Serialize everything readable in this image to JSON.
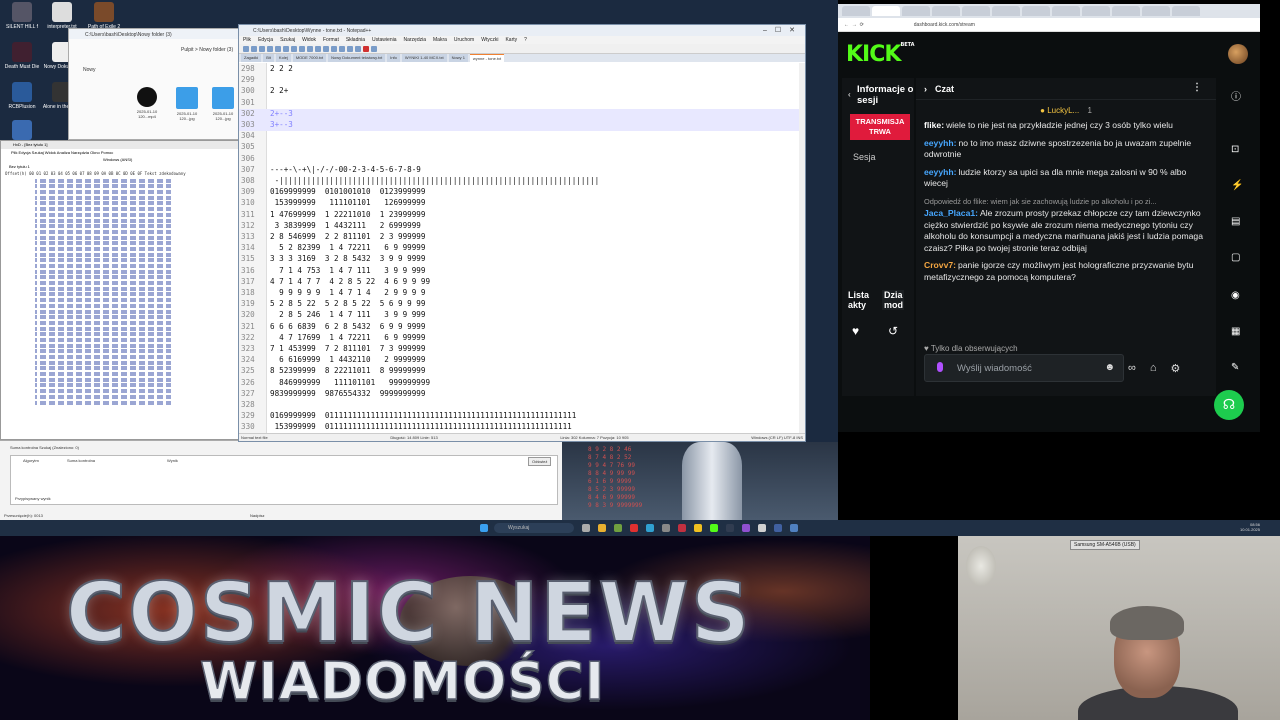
{
  "notepad": {
    "title": "C:\\Users\\bash\\Desktop\\Wynne - tone.txt - Notepad++",
    "menu": [
      "Plik",
      "Edycja",
      "Szukaj",
      "Widok",
      "Format",
      "Składnia",
      "Ustawienia",
      "Narzędzia",
      "Makra",
      "Uruchom",
      "Wtyczki",
      "Karty",
      "?"
    ],
    "tabs": [
      "Zagadki",
      "Bit",
      "Kolej",
      "MODE 7000.txt",
      "Nowy Dokument tekstowy.txt",
      "Info",
      "WYNIKI 1-40 MCX.txt",
      "Nowy 1",
      "wynne - tone.txt"
    ],
    "lines": [
      {
        "n": "298",
        "t": "2 2 2"
      },
      {
        "n": "299",
        "t": ""
      },
      {
        "n": "300",
        "t": "2 2+"
      },
      {
        "n": "301",
        "t": ""
      },
      {
        "n": "302",
        "t": "2+--3"
      },
      {
        "n": "303",
        "t": "3+--3"
      },
      {
        "n": "304",
        "t": ""
      },
      {
        "n": "305",
        "t": ""
      },
      {
        "n": "306",
        "t": ""
      },
      {
        "n": "307",
        "t": "---+-\\-+\\|-/-/-00-2-3-4-5-6-7-8-9"
      },
      {
        "n": "308",
        "t": " -||||||||||||||||||||||||||||||||||||||||||||||||||||||||||||||||||||||"
      },
      {
        "n": "309",
        "t": "0169999999  0101001010  0123999999"
      },
      {
        "n": "310",
        "t": " 153999999   111101101   126999999"
      },
      {
        "n": "311",
        "t": "1 47699999  1 22211010  1 23999999"
      },
      {
        "n": "312",
        "t": " 3 3839999  1 4432111   2 6999999"
      },
      {
        "n": "313",
        "t": "2 8 546999  2 2 811101  2 3 999999"
      },
      {
        "n": "314",
        "t": "  5 2 82399  1 4 72211   6 9 99999"
      },
      {
        "n": "315",
        "t": "3 3 3 3169  3 2 8 5432  3 9 9 9999"
      },
      {
        "n": "316",
        "t": "  7 1 4 753  1 4 7 111   3 9 9 999"
      },
      {
        "n": "317",
        "t": "4 7 1 4 7 7  4 2 8 5 22  4 6 9 9 99"
      },
      {
        "n": "318",
        "t": "  9 9 9 9 9  1 4 7 1 4   2 9 9 9 9"
      },
      {
        "n": "319",
        "t": "5 2 8 5 22  5 2 8 5 22  5 6 9 9 99"
      },
      {
        "n": "320",
        "t": "  2 8 5 246  1 4 7 111   3 9 9 999"
      },
      {
        "n": "321",
        "t": "6 6 6 6839  6 2 8 5432  6 9 9 9999"
      },
      {
        "n": "322",
        "t": "  4 7 17699  1 4 72211   6 9 99999"
      },
      {
        "n": "323",
        "t": "7 1 453999  7 2 811101  7 3 999999"
      },
      {
        "n": "324",
        "t": "  6 6169999  1 4432110   2 9999999"
      },
      {
        "n": "325",
        "t": "8 52399999  8 22211011  8 99999999"
      },
      {
        "n": "326",
        "t": "  846999999   111101101   999999999"
      },
      {
        "n": "327",
        "t": "9839999999  9876554332  9999999999"
      },
      {
        "n": "328",
        "t": ""
      },
      {
        "n": "329",
        "t": "0169999999  0111111111111111111111111111111111111111111111111111111"
      },
      {
        "n": "330",
        "t": " 153999999  011111111111111111111111111111111111111111111111111111"
      }
    ],
    "status_left": "Normal text file",
    "status_mid": "Długość: 14 809   Linie: 513",
    "status_pos": "Linia: 302   Kolumna: 7   Pozycja: 10 905",
    "status_right": "Windows (CR LF)   UTF-8   INS"
  },
  "explorer": {
    "title": "C:\\Users\\bash\\Desktop\\Nowy folder (3)",
    "new_label": "Nowy",
    "path": "Pulpit > Nowy folder (3)",
    "files": [
      "2025-01-10 120...mp4",
      "2025-01-10 120...jpg",
      "2025-01-10 120...jpg"
    ]
  },
  "hxd": {
    "title": "HxD - [Bez tytułu 1]",
    "menu": "Plik  Edycja  Szukaj  Widok  Analiza  Narzędzia  Okno  Pomoc",
    "encoding": "Windows (ANSI)",
    "tab": "Bez tytułu 1",
    "header": "Offset(h)  00 01 02 03 04 05 06 07 08 09 0A 0B 0C 0D 0E 0F  Tekst zdekodowany"
  },
  "checksum": {
    "tabs": "Suma kontrolna   Szukaj (Znaleziono: 0)",
    "cols": [
      "Algorytm",
      "Suma kontrolna",
      "Wynik"
    ],
    "ok": "Odśwież",
    "foot": "Przesunięcie(h): 0013",
    "foot2": "Nadpisz",
    "foot3": "Przypisywany wynik"
  },
  "gamebg": {
    "text": "8 9 2 8 2 46\n8 7 4 8 2 52\n9 9 4 7 76 99\n8 8 4 9 99 99\n6 1 6 9 9999\n8 5 2 3 99999\n8 4 6 9 99999\n9 8 3 9 9999999"
  },
  "taskbar": {
    "search": "Wyszukaj",
    "time": "08:56",
    "date": "10.01.2025"
  },
  "browser": {
    "url": "dashboard.kick.com/stream"
  },
  "kick": {
    "logo": "KICK",
    "beta": "BETA",
    "info_title": "Informacje o sesji",
    "live_label": "TRANSMISJA TRWA",
    "session": "Sesja",
    "lists_label": "Lista akty",
    "actions_label": "Dzia mod",
    "chat_title": "Czat",
    "pinned_user": "LuckyL...",
    "pinned_rank": "1",
    "messages": [
      {
        "user": "",
        "color": "#e8e8e8",
        "text": "",
        "reply": ""
      },
      {
        "user": "flike:",
        "color": "#ffffff",
        "text": "wiele to nie jest na przykładzie jednej czy 3 osób tylko wielu",
        "reply": ""
      },
      {
        "user": "eeyyhh:",
        "color": "#47a7ff",
        "text": "no to imo masz dziwne spostrzezenia bo ja uwazam zupelnie odwrotnie",
        "reply": ""
      },
      {
        "user": "eeyyhh:",
        "color": "#47a7ff",
        "text": "ludzie ktorzy sa upici sa dla mnie mega zalosni w 90 % albo wiecej",
        "reply": ""
      },
      {
        "user": "Jaca_Placa1:",
        "color": "#47a7ff",
        "text": "Ale zrozum prosty przekaz chłopcze czy tam dziewczynko ciężko stwierdzić po ksywie ale zrozum niema medycznego tytoniu czy alkoholu do konsumpcji a medyczna marihuana jakiś jest i ludzia pomaga czaisz? Piłka po twojej stronie teraz odbijaj",
        "reply": "Odpowiedź do flike: wiem jak sie zachowują ludzie po alkoholu i po zi..."
      },
      {
        "user": "Crovv7:",
        "color": "#f4a642",
        "text": "panie igorze czy możliwym jest holograficzne przyzwanie bytu metafizycznego za pomocą komputera?",
        "reply": ""
      }
    ],
    "follow_only": "Tylko dla obserwujących",
    "input_placeholder": "Wyślij wiadomość"
  },
  "cosmic": {
    "line1": "COSMIC NEWS",
    "line2": "WIADOMOŚCI"
  },
  "webcam": {
    "label": "Samsung SM-A546B (USB)"
  }
}
